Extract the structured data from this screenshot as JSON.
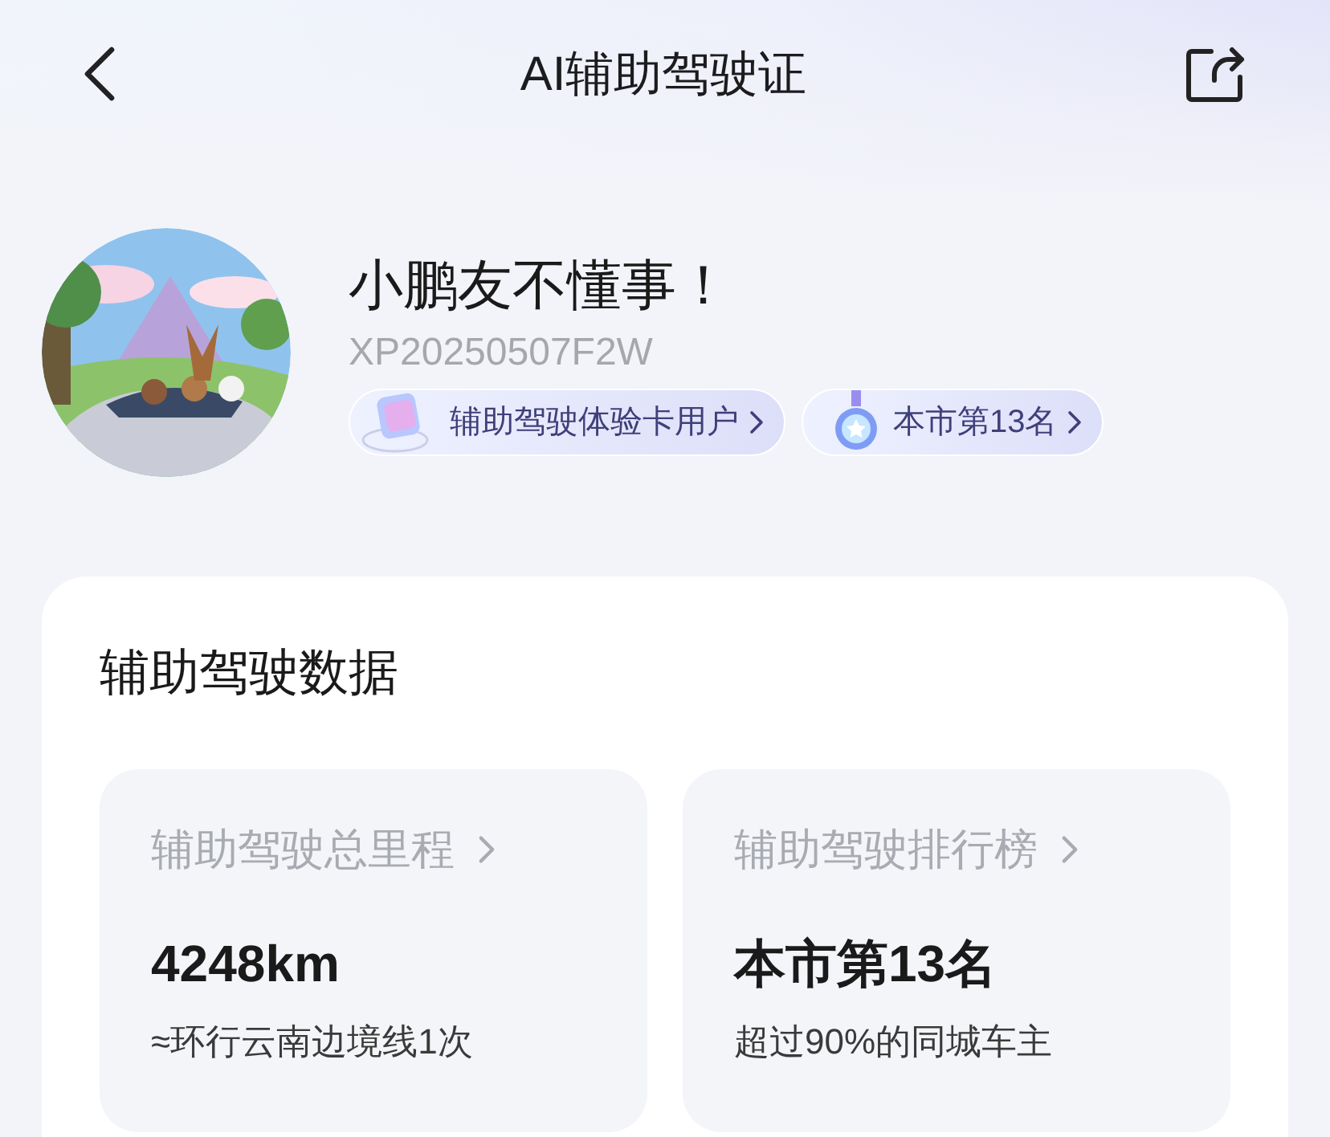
{
  "header": {
    "title": "AI辅助驾驶证"
  },
  "profile": {
    "name": "小鹏友不懂事！",
    "id": "XP20250507F2W",
    "badges": [
      {
        "kind": "card",
        "label": "辅助驾驶体验卡用户"
      },
      {
        "kind": "medal",
        "label": "本市第13名"
      }
    ]
  },
  "data_card": {
    "title": "辅助驾驶数据",
    "stats": [
      {
        "label": "辅助驾驶总里程",
        "value": "4248km",
        "note": "≈环行云南边境线1次"
      },
      {
        "label": "辅助驾驶排行榜",
        "value": "本市第13名",
        "note": "超过90%的同城车主"
      }
    ]
  }
}
